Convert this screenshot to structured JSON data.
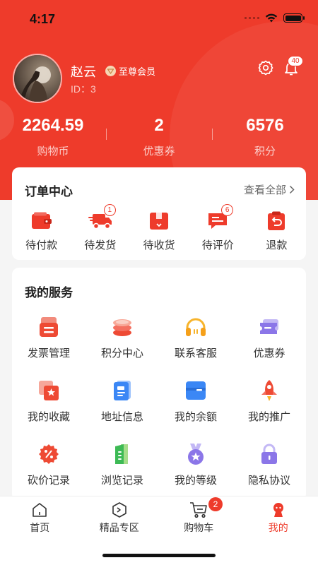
{
  "status_bar": {
    "time": "4:17"
  },
  "profile": {
    "name": "赵云",
    "vip_label": "至尊会员",
    "id_text": "ID：3",
    "notification_count": "40"
  },
  "stats": [
    {
      "value": "2264.59",
      "label": "购物币"
    },
    {
      "value": "2",
      "label": "优惠券"
    },
    {
      "value": "6576",
      "label": "积分"
    }
  ],
  "orders": {
    "title": "订单中心",
    "view_all": "查看全部",
    "items": [
      {
        "label": "待付款",
        "icon": "wallet-icon",
        "badge": ""
      },
      {
        "label": "待发货",
        "icon": "truck-icon",
        "badge": "1"
      },
      {
        "label": "待收货",
        "icon": "box-icon",
        "badge": ""
      },
      {
        "label": "待评价",
        "icon": "comment-icon",
        "badge": "6"
      },
      {
        "label": "退款",
        "icon": "refund-icon",
        "badge": ""
      }
    ]
  },
  "services": {
    "title": "我的服务",
    "items": [
      {
        "label": "发票管理",
        "icon": "invoice-icon"
      },
      {
        "label": "积分中心",
        "icon": "coins-icon"
      },
      {
        "label": "联系客服",
        "icon": "headset-icon"
      },
      {
        "label": "优惠券",
        "icon": "ticket-icon"
      },
      {
        "label": "我的收藏",
        "icon": "star-card-icon"
      },
      {
        "label": "地址信息",
        "icon": "address-icon"
      },
      {
        "label": "我的余额",
        "icon": "balance-icon"
      },
      {
        "label": "我的推广",
        "icon": "rocket-icon"
      },
      {
        "label": "砍价记录",
        "icon": "discount-icon"
      },
      {
        "label": "浏览记录",
        "icon": "history-icon"
      },
      {
        "label": "我的等级",
        "icon": "medal-icon"
      },
      {
        "label": "隐私协议",
        "icon": "lock-icon"
      }
    ]
  },
  "tabbar": {
    "items": [
      {
        "label": "首页",
        "icon": "home-icon"
      },
      {
        "label": "精品专区",
        "icon": "premium-icon"
      },
      {
        "label": "购物车",
        "icon": "cart-icon",
        "badge": "2"
      },
      {
        "label": "我的",
        "icon": "user-icon"
      }
    ]
  },
  "colors": {
    "primary": "#ee3b2b",
    "background": "#f5f5f5"
  }
}
